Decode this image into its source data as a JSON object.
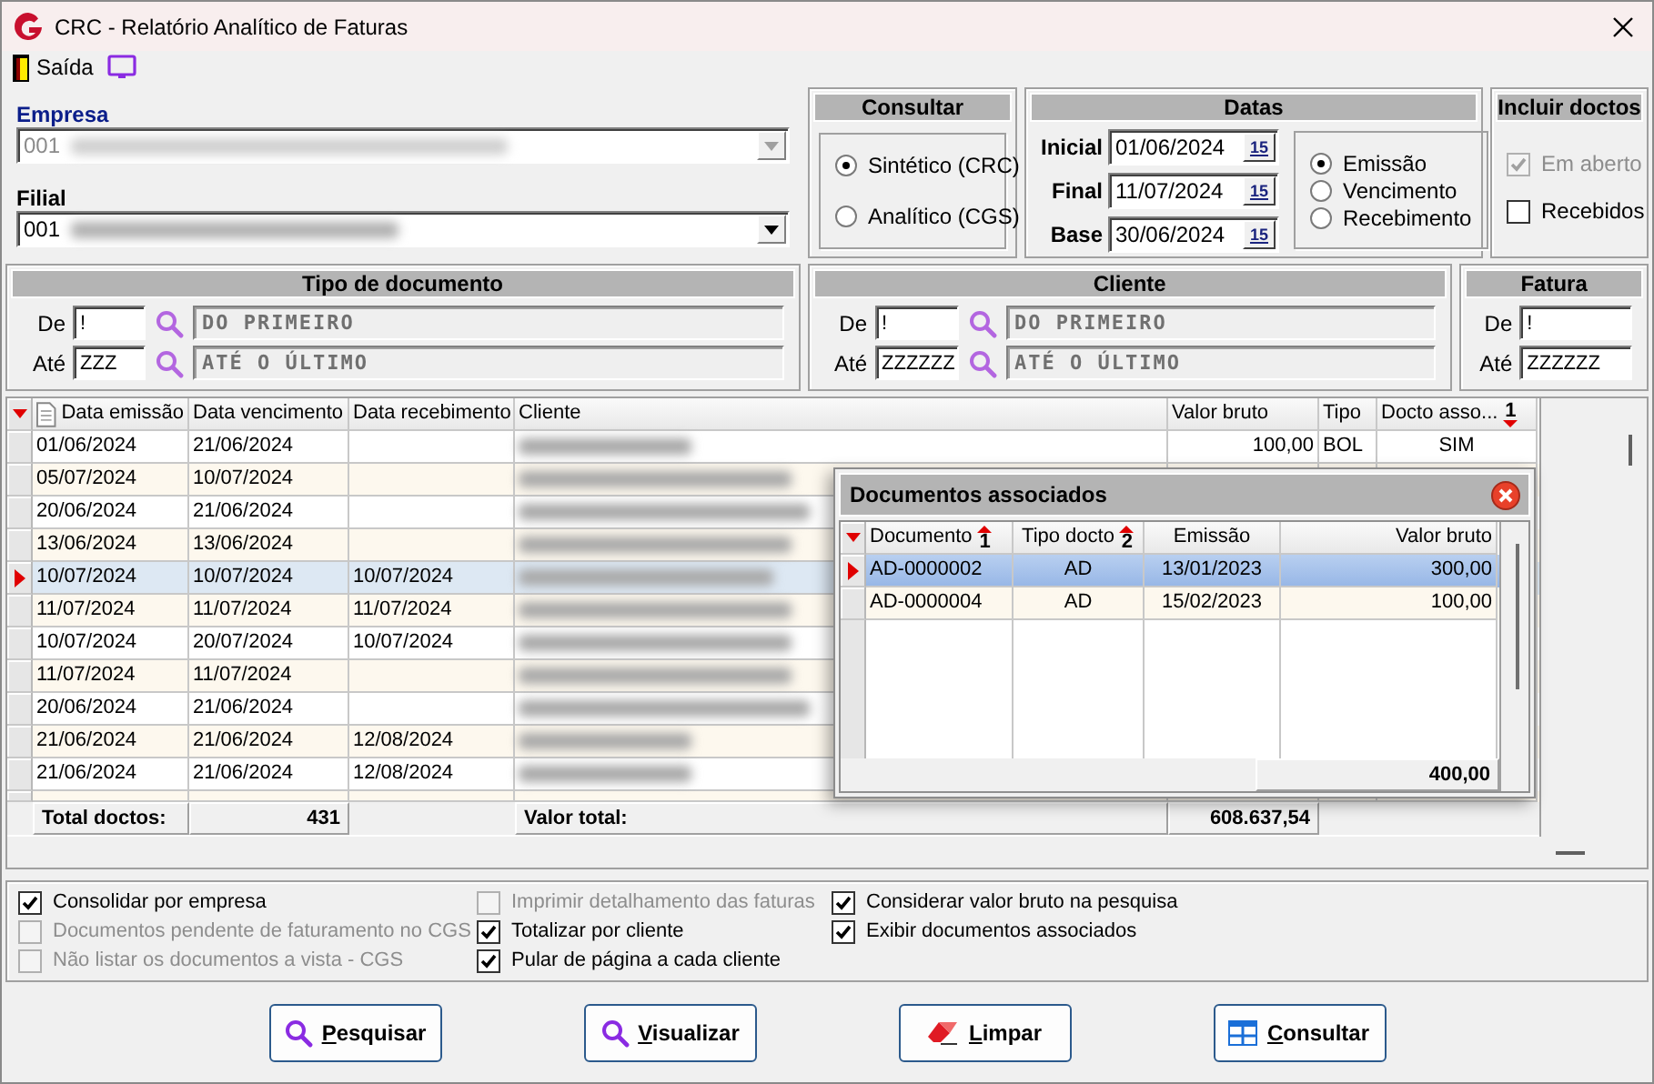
{
  "window": {
    "title": "CRC - Relatório Analítico de Faturas"
  },
  "toolbar": {
    "exit_label": "Saída"
  },
  "empresa": {
    "label": "Empresa",
    "code": "001",
    "disabled": true
  },
  "filial": {
    "label": "Filial",
    "code": "001",
    "disabled": false
  },
  "consultar": {
    "title": "Consultar",
    "options": [
      {
        "label": "Sintético (CRC)",
        "selected": true
      },
      {
        "label": "Analítico (CGS)",
        "selected": false
      }
    ]
  },
  "datas": {
    "title": "Datas",
    "fields": [
      {
        "label": "Inicial",
        "value": "01/06/2024",
        "button": "15"
      },
      {
        "label": "Final",
        "value": "11/07/2024",
        "button": "15"
      },
      {
        "label": "Base",
        "value": "30/06/2024",
        "button": "15"
      }
    ],
    "options": [
      {
        "label": "Emissão",
        "selected": true
      },
      {
        "label": "Vencimento",
        "selected": false
      },
      {
        "label": "Recebimento",
        "selected": false
      }
    ]
  },
  "incluir": {
    "title": "Incluir doctos",
    "options": [
      {
        "label": "Em aberto",
        "checked": true,
        "disabled": true
      },
      {
        "label": "Recebidos",
        "checked": false,
        "disabled": false
      }
    ]
  },
  "tipo_documento": {
    "title": "Tipo de documento",
    "rows": [
      {
        "label": "De",
        "value": "!",
        "description": "DO PRIMEIRO"
      },
      {
        "label": "Até",
        "value": "ZZZ",
        "description": "ATÉ O ÚLTIMO"
      }
    ]
  },
  "cliente": {
    "title": "Cliente",
    "rows": [
      {
        "label": "De",
        "value": "!",
        "description": "DO PRIMEIRO"
      },
      {
        "label": "Até",
        "value": "ZZZZZZ",
        "description": "ATÉ O ÚLTIMO"
      }
    ]
  },
  "fatura": {
    "title": "Fatura",
    "rows": [
      {
        "label": "De",
        "value": "!"
      },
      {
        "label": "Até",
        "value": "ZZZZZZ"
      }
    ]
  },
  "grid": {
    "columns": [
      {
        "label": "Data emissão"
      },
      {
        "label": "Data vencimento"
      },
      {
        "label": "Data recebimento"
      },
      {
        "label": "Cliente"
      },
      {
        "label": "Valor bruto"
      },
      {
        "label": "Tipo"
      },
      {
        "label": "Docto asso...",
        "sort": {
          "order": "1",
          "descending": true
        }
      }
    ],
    "rows": [
      {
        "selected": false,
        "cells": [
          "01/06/2024",
          "21/06/2024",
          "",
          "",
          "100,00",
          "BOL",
          "SIM"
        ]
      },
      {
        "selected": false,
        "cells": [
          "05/07/2024",
          "10/07/2024",
          "",
          ""
        ]
      },
      {
        "selected": false,
        "cells": [
          "20/06/2024",
          "21/06/2024",
          "",
          ""
        ]
      },
      {
        "selected": false,
        "cells": [
          "13/06/2024",
          "13/06/2024",
          "",
          ""
        ]
      },
      {
        "selected": true,
        "cells": [
          "10/07/2024",
          "10/07/2024",
          "10/07/2024",
          ""
        ]
      },
      {
        "selected": false,
        "cells": [
          "11/07/2024",
          "11/07/2024",
          "11/07/2024",
          ""
        ]
      },
      {
        "selected": false,
        "cells": [
          "10/07/2024",
          "20/07/2024",
          "10/07/2024",
          ""
        ]
      },
      {
        "selected": false,
        "cells": [
          "11/07/2024",
          "11/07/2024",
          "",
          ""
        ]
      },
      {
        "selected": false,
        "cells": [
          "20/06/2024",
          "21/06/2024",
          "",
          ""
        ]
      },
      {
        "selected": false,
        "cells": [
          "21/06/2024",
          "21/06/2024",
          "12/08/2024",
          ""
        ]
      },
      {
        "selected": false,
        "cells": [
          "21/06/2024",
          "21/06/2024",
          "12/08/2024",
          ""
        ]
      }
    ],
    "footer": {
      "count_label": "Total doctos:",
      "count": "431",
      "total_label": "Valor total:",
      "total": "608.637,54"
    }
  },
  "popup": {
    "title": "Documentos associados",
    "columns": [
      {
        "label": "Documento",
        "sort": {
          "order": "1",
          "descending": false
        }
      },
      {
        "label": "Tipo docto",
        "sort": {
          "order": "2",
          "descending": false
        }
      },
      {
        "label": "Emissão"
      },
      {
        "label": "Valor bruto"
      }
    ],
    "rows": [
      {
        "selected": true,
        "cells": [
          "AD-0000002",
          "AD",
          "13/01/2023",
          "300,00"
        ]
      },
      {
        "selected": false,
        "cells": [
          "AD-0000004",
          "AD",
          "15/02/2023",
          "100,00"
        ]
      }
    ],
    "total": "400,00"
  },
  "options": [
    {
      "label": "Consolidar por empresa",
      "checked": true,
      "disabled": false
    },
    {
      "label": "Documentos pendente de faturamento no CGS",
      "checked": false,
      "disabled": true
    },
    {
      "label": "Não listar os documentos a vista - CGS",
      "checked": false,
      "disabled": true
    },
    {
      "label": "Imprimir detalhamento das faturas",
      "checked": false,
      "disabled": true
    },
    {
      "label": "Totalizar por cliente",
      "checked": true,
      "disabled": false
    },
    {
      "label": "Pular de página a cada cliente",
      "checked": true,
      "disabled": false
    },
    {
      "label": "Considerar valor bruto na pesquisa",
      "checked": true,
      "disabled": false
    },
    {
      "label": "Exibir documentos associados",
      "checked": true,
      "disabled": false
    }
  ],
  "buttons": [
    {
      "label": "Pesquisar",
      "kind": "search"
    },
    {
      "label": "Visualizar",
      "kind": "search"
    },
    {
      "label": "Limpar",
      "kind": "eraser"
    },
    {
      "label": "Consultar",
      "kind": "table"
    }
  ]
}
